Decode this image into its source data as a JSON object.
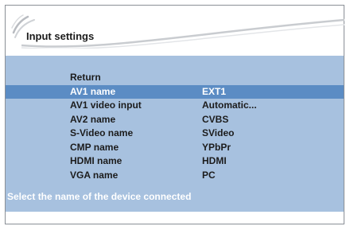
{
  "screen": {
    "title": "Input settings",
    "hint": "Select the name of the device connected"
  },
  "menu": [
    {
      "label": "Return",
      "value": "",
      "selected": false
    },
    {
      "label": "AV1 name",
      "value": "EXT1",
      "selected": true
    },
    {
      "label": "AV1 video input",
      "value": "Automatic...",
      "selected": false
    },
    {
      "label": "AV2 name",
      "value": "CVBS",
      "selected": false
    },
    {
      "label": "S-Video name",
      "value": "SVideo",
      "selected": false
    },
    {
      "label": "CMP name",
      "value": "YPbPr",
      "selected": false
    },
    {
      "label": "HDMI name",
      "value": "HDMI",
      "selected": false
    },
    {
      "label": "VGA name",
      "value": "PC",
      "selected": false
    }
  ],
  "colors": {
    "panel": "#a7c1df",
    "highlight": "#5b8cc4",
    "text": "#1c1c1c",
    "hint_text": "#ffffff"
  },
  "icons": {
    "header_decoration": "swoosh-logo-icon"
  }
}
